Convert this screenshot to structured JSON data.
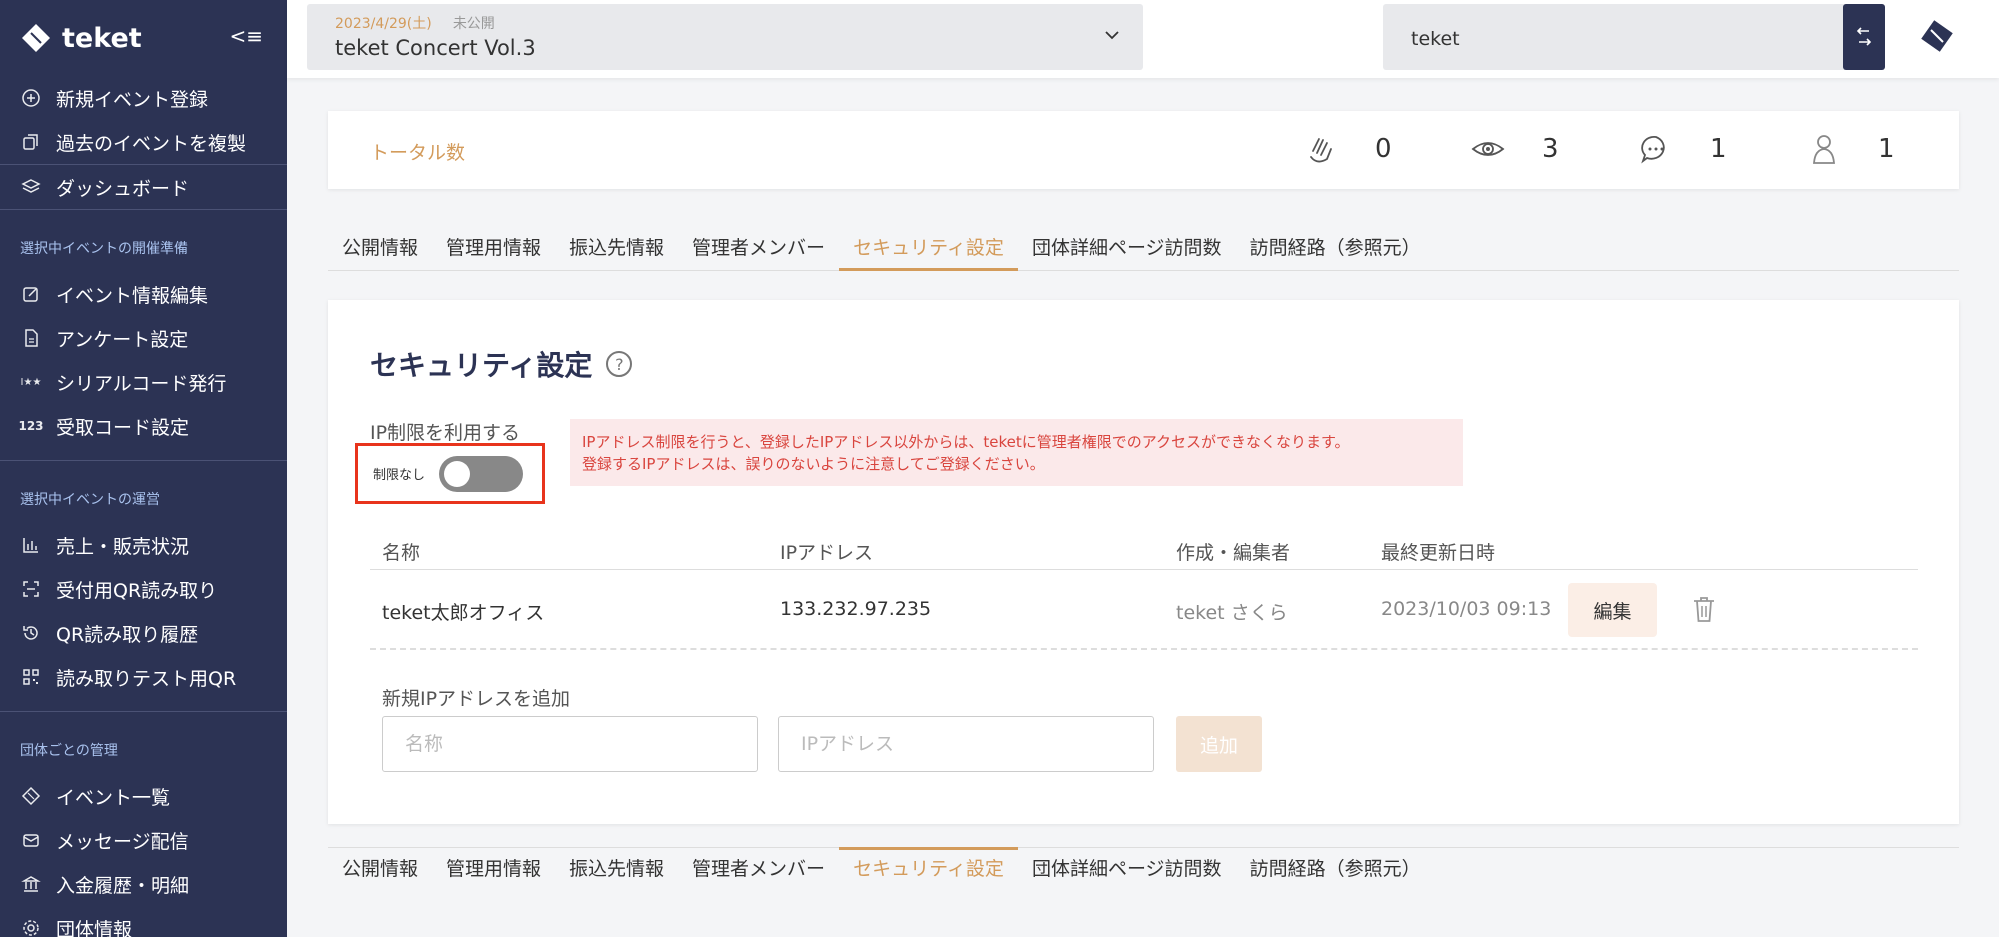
{
  "brand": {
    "name": "teket",
    "collapse_icon": "<≡"
  },
  "sidebar": {
    "top_items": [
      {
        "label": "新規イベント登録",
        "icon": "plus-circle-icon"
      },
      {
        "label": "過去のイベントを複製",
        "icon": "copy-icon"
      },
      {
        "label": "ダッシュボード",
        "icon": "layers-icon"
      }
    ],
    "section1": "選択中イベントの開催準備",
    "prep_items": [
      {
        "label": "イベント情報編集",
        "icon": "edit-icon"
      },
      {
        "label": "アンケート設定",
        "icon": "document-icon"
      },
      {
        "label": "シリアルコード発行",
        "icon": "serial-code-icon",
        "glyph": "I★★"
      },
      {
        "label": "受取コード設定",
        "icon": "code-123-icon",
        "glyph": "123"
      }
    ],
    "section2": "選択中イベントの運営",
    "ops_items": [
      {
        "label": "売上・販売状況",
        "icon": "bar-chart-icon"
      },
      {
        "label": "受付用QR読み取り",
        "icon": "qr-scan-icon"
      },
      {
        "label": "QR読み取り履歴",
        "icon": "history-icon"
      },
      {
        "label": "読み取りテスト用QR",
        "icon": "qr-code-icon"
      }
    ],
    "section3": "団体ごとの管理",
    "org_items": [
      {
        "label": "イベント一覧",
        "icon": "ticket-icon"
      },
      {
        "label": "メッセージ配信",
        "icon": "mail-icon"
      },
      {
        "label": "入金履歴・明細",
        "icon": "bank-icon"
      },
      {
        "label": "団体情報",
        "icon": "gear-icon"
      }
    ]
  },
  "topbar": {
    "event_date": "2023/4/29(土)",
    "event_status": "未公開",
    "event_title": "teket Concert Vol.3",
    "org_name": "teket"
  },
  "stats": {
    "label": "トータル数",
    "claps": "0",
    "views": "3",
    "comments": "1",
    "users": "1"
  },
  "tabs": [
    {
      "label": "公開情報",
      "active": false
    },
    {
      "label": "管理用情報",
      "active": false
    },
    {
      "label": "振込先情報",
      "active": false
    },
    {
      "label": "管理者メンバー",
      "active": false
    },
    {
      "label": "セキュリティ設定",
      "active": true
    },
    {
      "label": "団体詳細ページ訪問数",
      "active": false
    },
    {
      "label": "訪問経路（参照元）",
      "active": false
    }
  ],
  "security": {
    "title": "セキュリティ設定",
    "help": "?",
    "ip_label": "IP制限を利用する",
    "toggle_text": "制限なし",
    "notice_line1": "IPアドレス制限を行うと、登録したIPアドレス以外からは、teketに管理者権限でのアクセスができなくなります。",
    "notice_line2": "登録するIPアドレスは、誤りのないように注意してご登録ください。",
    "columns": {
      "name": "名称",
      "ip": "IPアドレス",
      "editor": "作成・編集者",
      "updated": "最終更新日時"
    },
    "rows": [
      {
        "name": "teket太郎オフィス",
        "ip": "133.232.97.235",
        "editor": "teket さくら",
        "updated": "2023/10/03 09:13",
        "edit_label": "編集"
      }
    ],
    "add_label": "新規IPアドレスを追加",
    "name_placeholder": "名称",
    "ip_placeholder": "IPアドレス",
    "add_button": "追加"
  },
  "colors": {
    "sidebar": "#2c3354",
    "accent": "#d39b5b",
    "alert": "#e8341c"
  }
}
